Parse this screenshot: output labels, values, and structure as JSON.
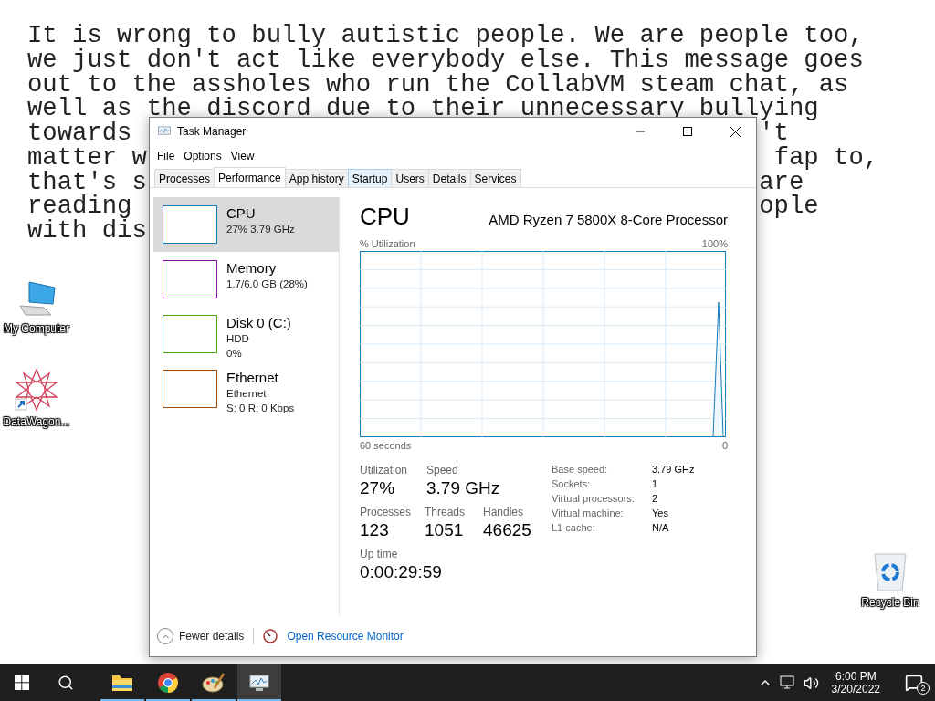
{
  "wallpaper_text": [
    {
      "left": "It is wrong to bully autistic people. We are people too,"
    },
    {
      "left": "we just don't act like everybody else. This message goes"
    },
    {
      "left": "out to the assholes who run the CollabVM steam chat, as"
    },
    {
      "left": "well as the discord due to their unnecessary bullying"
    },
    {
      "left": "towards",
      "right": "'t"
    },
    {
      "left": "matter w",
      "right": "fap to,"
    },
    {
      "left": "that's s",
      "right": "are"
    },
    {
      "left": "reading",
      "right": "ople"
    },
    {
      "left": "with dis"
    }
  ],
  "desktop_icons": [
    {
      "kind": "computer",
      "label": "My Computer"
    },
    {
      "kind": "shortcut",
      "label": "DataWagon..."
    },
    {
      "kind": "recycle",
      "label": "Recycle Bin"
    }
  ],
  "window": {
    "title": "Task Manager",
    "menu": [
      "File",
      "Options",
      "View"
    ],
    "tabs": [
      {
        "label": "Processes",
        "selected": false,
        "hovered": false
      },
      {
        "label": "Performance",
        "selected": true,
        "hovered": false
      },
      {
        "label": "App history",
        "selected": false,
        "hovered": false
      },
      {
        "label": "Startup",
        "selected": false,
        "hovered": true
      },
      {
        "label": "Users",
        "selected": false,
        "hovered": false
      },
      {
        "label": "Details",
        "selected": false,
        "hovered": false
      },
      {
        "label": "Services",
        "selected": false,
        "hovered": false
      }
    ],
    "resources": [
      {
        "name": "CPU",
        "lines": [
          "27%  3.79 GHz"
        ],
        "color": "#117dbb",
        "selected": true
      },
      {
        "name": "Memory",
        "lines": [
          "1.7/6.0 GB (28%)"
        ],
        "color": "#8b12ae",
        "selected": false
      },
      {
        "name": "Disk 0 (C:)",
        "lines": [
          "HDD",
          "0%"
        ],
        "color": "#4da60c",
        "selected": false
      },
      {
        "name": "Ethernet",
        "lines": [
          "Ethernet",
          "S: 0 R: 0 Kbps"
        ],
        "color": "#a74f01",
        "selected": false
      }
    ],
    "detail": {
      "title": "CPU",
      "model": "AMD Ryzen 7 5800X 8-Core Processor",
      "axis_label": "% Utilization",
      "axis_max": "100%",
      "time_label": "60 seconds",
      "time_end": "0",
      "stats": [
        {
          "label": "Utilization",
          "value": "27%"
        },
        {
          "label": "Speed",
          "value": "3.79 GHz"
        }
      ],
      "counts": [
        {
          "label": "Processes",
          "value": "123"
        },
        {
          "label": "Threads",
          "value": "1051"
        },
        {
          "label": "Handles",
          "value": "46625"
        }
      ],
      "uptime": {
        "label": "Up time",
        "value": "0:00:29:59"
      },
      "specs": [
        {
          "label": "Base speed:",
          "value": "3.79 GHz"
        },
        {
          "label": "Sockets:",
          "value": "1"
        },
        {
          "label": "Virtual processors:",
          "value": "2"
        },
        {
          "label": "Virtual machine:",
          "value": "Yes"
        },
        {
          "label": "L1 cache:",
          "value": "N/A"
        }
      ]
    },
    "footer": {
      "fewer": "Fewer details",
      "link": "Open Resource Monitor"
    }
  },
  "taskbar": {
    "apps": [
      {
        "kind": "folder",
        "open": true,
        "active": false
      },
      {
        "kind": "browser",
        "open": true,
        "active": false
      },
      {
        "kind": "palette",
        "open": true,
        "active": false
      },
      {
        "kind": "monitor",
        "open": true,
        "active": true
      }
    ],
    "time": "6:00 PM",
    "date": "3/20/2022",
    "notifications": "2"
  }
}
